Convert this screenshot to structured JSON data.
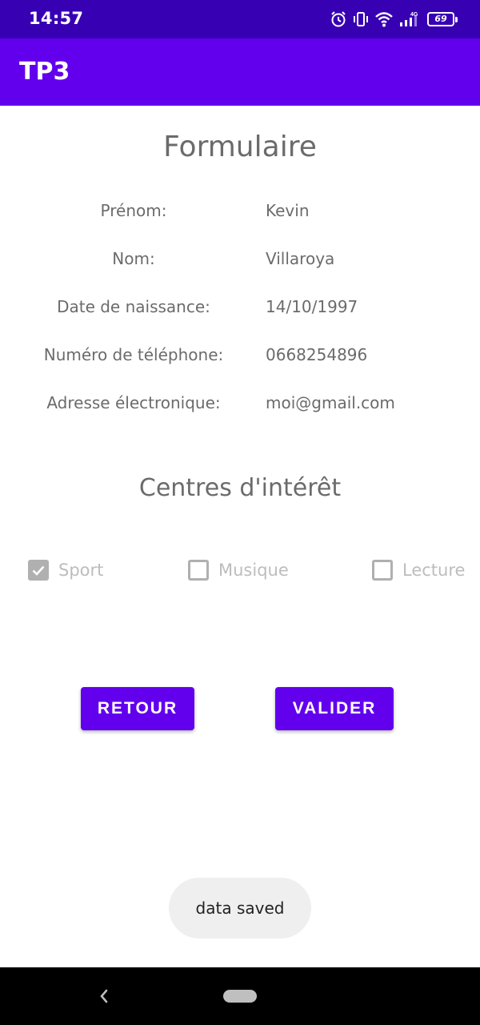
{
  "status_bar": {
    "time": "14:57",
    "network": "4G",
    "battery": "69",
    "icons": [
      "alarm-icon",
      "vibrate-icon",
      "wifi-icon",
      "signal-icon",
      "battery-icon"
    ]
  },
  "app_bar": {
    "title": "TP3",
    "color": "#6200ee"
  },
  "form": {
    "title": "Formulaire",
    "fields": [
      {
        "label": "Prénom:",
        "value": "Kevin"
      },
      {
        "label": "Nom:",
        "value": "Villaroya"
      },
      {
        "label": "Date de naissance:",
        "value": "14/10/1997"
      },
      {
        "label": "Numéro de téléphone:",
        "value": "0668254896"
      },
      {
        "label": "Adresse électronique:",
        "value": "moi@gmail.com"
      }
    ]
  },
  "interests": {
    "title": "Centres d'intérêt",
    "options": [
      {
        "label": "Sport",
        "checked": true
      },
      {
        "label": "Musique",
        "checked": false
      },
      {
        "label": "Lecture",
        "checked": false
      }
    ]
  },
  "buttons": {
    "back_label": "RETOUR",
    "validate_label": "VALIDER"
  },
  "toast": {
    "message": "data saved"
  },
  "colors": {
    "primary": "#6200ee",
    "primary_dark": "#3700b3",
    "text_secondary": "#6b6b6b",
    "disabled": "#b0b0b0"
  }
}
